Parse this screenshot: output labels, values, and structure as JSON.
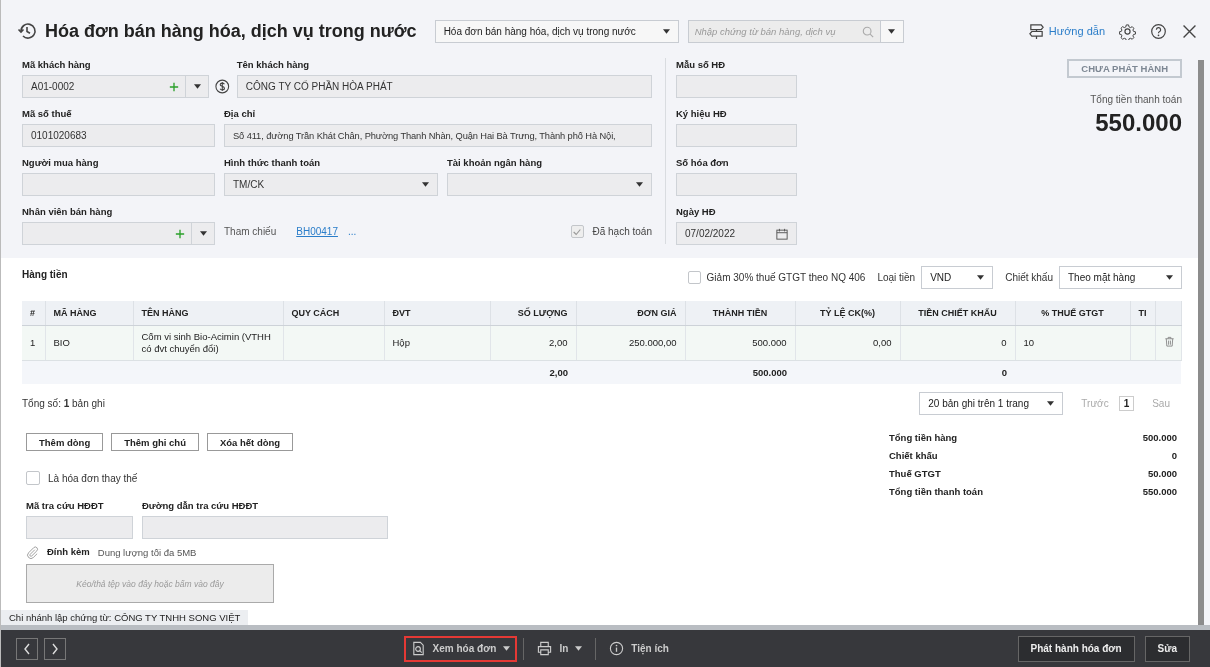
{
  "header": {
    "title": "Hóa đơn bán hàng hóa, dịch vụ trong nước",
    "doc_type": "Hóa đơn bán hàng hóa, dịch vụ trong nước",
    "search": {
      "placeholder": "Nhập chứng từ bán hàng, dịch vụ"
    },
    "guide_link": "Hướng dẫn"
  },
  "form": {
    "customer_code": {
      "label": "Mã khách hàng",
      "value": "A01-0002"
    },
    "customer_name": {
      "label": "Tên khách hàng",
      "value": "CÔNG TY CỔ PHẦN HÒA PHÁT"
    },
    "tax_code": {
      "label": "Mã số thuế",
      "value": "0101020683"
    },
    "address": {
      "label": "Địa chỉ",
      "value": "Số 411, đường Trần Khát Chân, Phường Thanh Nhàn, Quận Hai Bà Trưng, Thành phố Hà Nội,"
    },
    "buyer": {
      "label": "Người mua hàng"
    },
    "payment_method": {
      "label": "Hình thức thanh toán",
      "value": "TM/CK"
    },
    "bank_account": {
      "label": "Tài khoản ngân hàng"
    },
    "salesperson": {
      "label": "Nhân viên bán hàng"
    },
    "reference": {
      "label": "Tham chiếu",
      "link": "BH00417",
      "more": "..."
    },
    "posted": {
      "label": "Đã hạch toán",
      "checked": true
    },
    "invoice_template": {
      "label": "Mẫu số HĐ"
    },
    "invoice_symbol": {
      "label": "Ký hiệu HĐ"
    },
    "invoice_number": {
      "label": "Số hóa đơn"
    },
    "invoice_date": {
      "label": "Ngày HĐ",
      "value": "07/02/2022"
    },
    "status_badge": "CHƯA PHÁT HÀNH",
    "total_label": "Tổng tiền thanh toán",
    "total_value": "550.000"
  },
  "items": {
    "title": "Hàng tiền",
    "vat_reduction": {
      "label": "Giảm 30% thuế GTGT theo NQ 406",
      "checked": false
    },
    "currency": {
      "label": "Loại tiền",
      "value": "VND"
    },
    "discount": {
      "label": "Chiết khấu",
      "value": "Theo mặt hàng"
    },
    "columns": [
      "#",
      "MÃ HÀNG",
      "TÊN HÀNG",
      "QUY CÁCH",
      "ĐVT",
      "SỐ LƯỢNG",
      "ĐƠN GIÁ",
      "THÀNH TIỀN",
      "TỶ LỆ CK(%)",
      "TIỀN CHIẾT KHẤU",
      "% THUẾ GTGT",
      "TI"
    ],
    "rows": [
      {
        "no": "1",
        "code": "BIO",
        "name": "Cốm vi sinh Bio-Acimin (VTHH có đvt chuyển đổi)",
        "unit": "Hộp",
        "quantity": "2,00",
        "unit_price": "250.000,00",
        "amount": "500.000",
        "discount_rate": "0,00",
        "discount_amount": "0",
        "vat_rate": "10"
      }
    ],
    "totals": {
      "quantity": "2,00",
      "amount": "500.000",
      "discount_amount": "0"
    },
    "record_count": "Tổng số: **1** bản ghi",
    "pager": {
      "page_size": "20 bản ghi trên 1 trang",
      "prev": "Trước",
      "page": "1",
      "next": "Sau"
    },
    "buttons": [
      "Thêm dòng",
      "Thêm ghi chú",
      "Xóa hết dòng"
    ]
  },
  "replacement": {
    "label": "Là hóa đơn thay thế",
    "checked": false
  },
  "lookup_code": {
    "label": "Mã tra cứu HĐĐT"
  },
  "lookup_url": {
    "label": "Đường dẫn tra cứu HĐĐT"
  },
  "attachment": {
    "label": "Đính kèm",
    "hint": "Dung lượng tối đa 5MB",
    "drop_text": "Kéo/thả tệp vào đây hoặc bấm vào đây"
  },
  "summary": [
    {
      "label": "Tổng tiền hàng",
      "value": "500.000"
    },
    {
      "label": "Chiết khấu",
      "value": "0"
    },
    {
      "label": "Thuế GTGT",
      "value": "50.000"
    },
    {
      "label": "Tổng tiền thanh toán",
      "value": "550.000"
    }
  ],
  "branch": "Chi nhánh lập chứng từ: CÔNG TY TNHH SONG VIỆT",
  "toolbar": {
    "actions": [
      {
        "kind": "view",
        "label": "Xem hóa đơn",
        "dropdown": true,
        "highlighted": true
      },
      {
        "kind": "print",
        "label": "In",
        "dropdown": true,
        "highlighted": false
      },
      {
        "kind": "utilities",
        "label": "Tiện ích",
        "dropdown": false,
        "highlighted": false
      }
    ],
    "buttons": [
      "Phát hành hóa đơn",
      "Sửa"
    ]
  }
}
